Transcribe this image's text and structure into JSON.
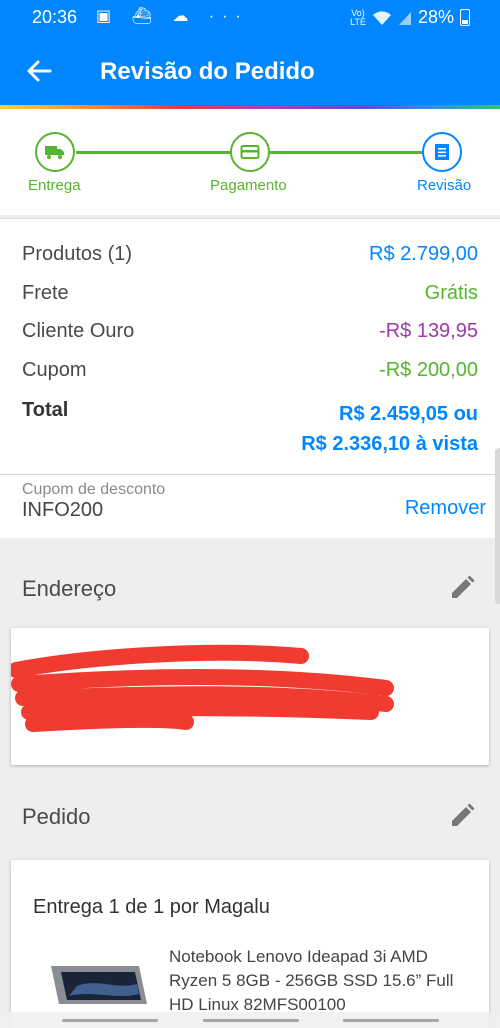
{
  "status_bar": {
    "time": "20:36",
    "icons": "▣ ⛴ ☁ ···",
    "lte": "Vo)\nLTE",
    "battery": "28%"
  },
  "app_bar": {
    "title": "Revisão do Pedido"
  },
  "stepper": {
    "steps": [
      {
        "label": "Entrega"
      },
      {
        "label": "Pagamento"
      },
      {
        "label": "Revisão"
      }
    ]
  },
  "summary": {
    "rows": [
      {
        "label": "Produtos (1)",
        "value": "R$ 2.799,00",
        "color": "#0086ff"
      },
      {
        "label": "Frete",
        "value": "Grátis",
        "color": "#55b52d"
      },
      {
        "label": "Cliente Ouro",
        "value": "-R$ 139,95",
        "color": "#9c3aa6"
      },
      {
        "label": "Cupom",
        "value": "-R$ 200,00",
        "color": "#55b52d"
      }
    ],
    "total_label": "Total",
    "total_line1": "R$ 2.459,05 ou",
    "total_line2": "R$ 2.336,10 à vista"
  },
  "coupon": {
    "label": "Cupom de desconto",
    "code": "INFO200",
    "remove": "Remover"
  },
  "address": {
    "title": "Endereço"
  },
  "order": {
    "title": "Pedido",
    "shipment": "Entrega 1 de 1 por Magalu",
    "product_name": "Notebook Lenovo Ideapad 3i AMD Ryzen 5 8GB - 256GB SSD 15.6” Full HD Linux 82MFS00100"
  }
}
